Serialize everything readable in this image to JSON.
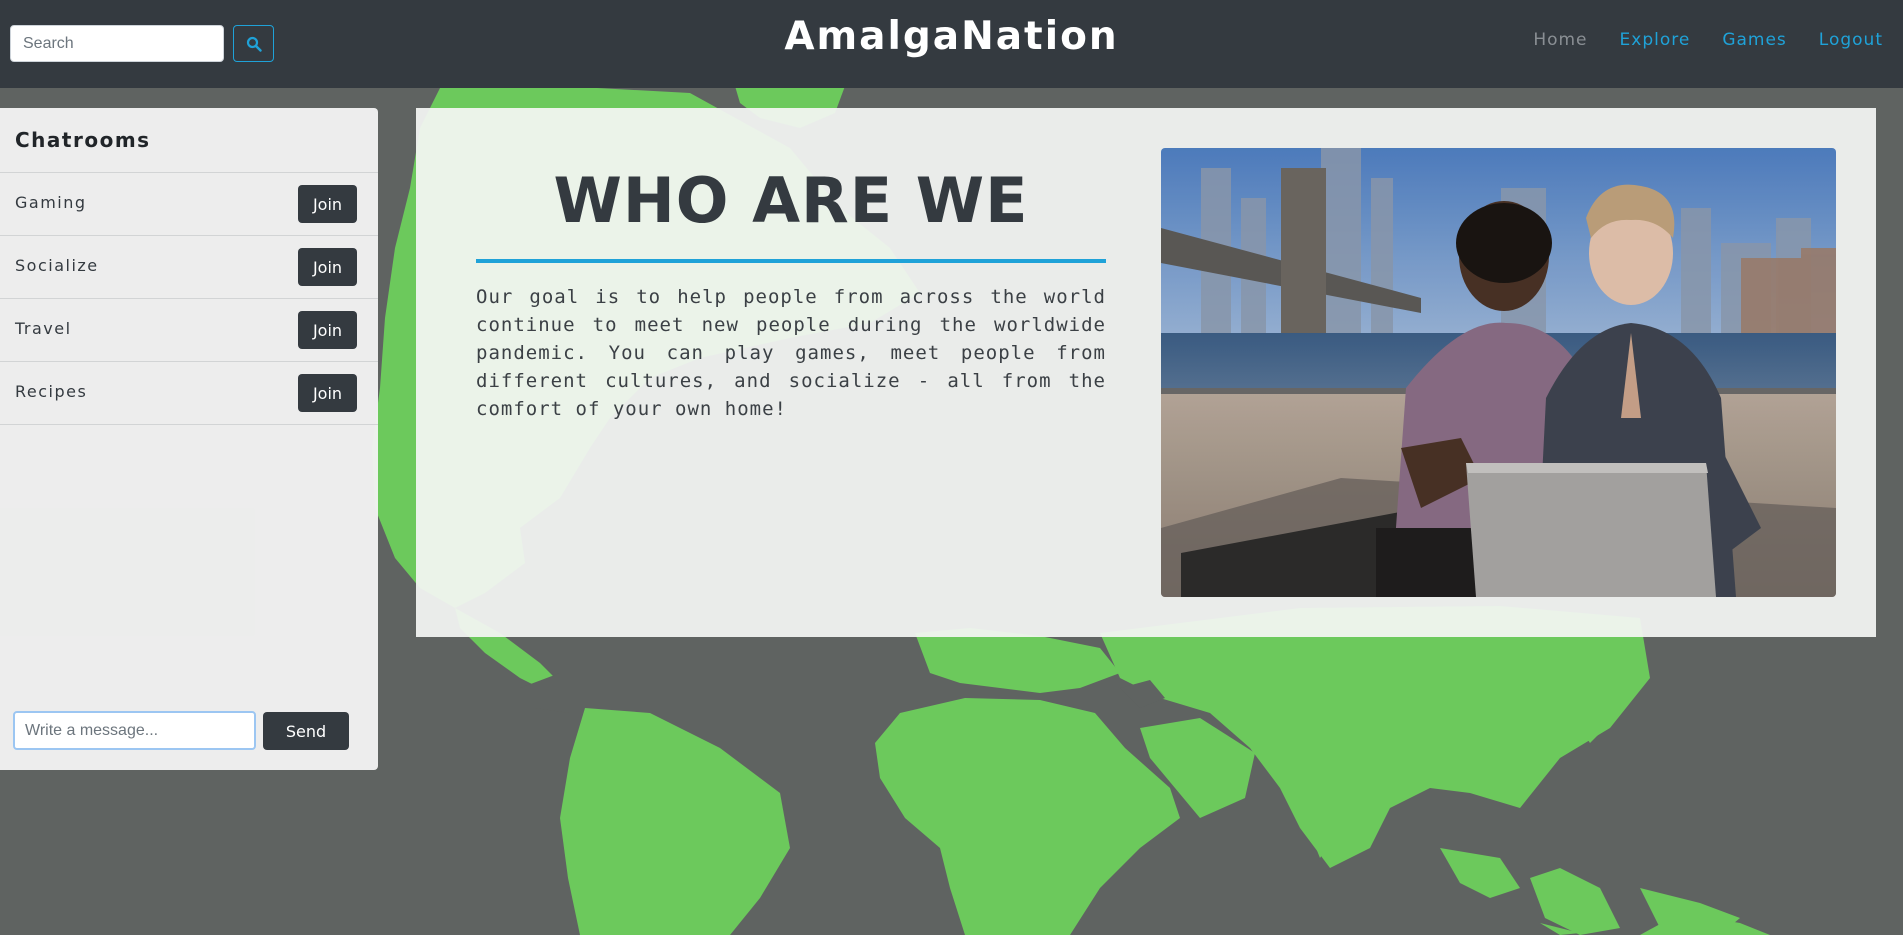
{
  "header": {
    "brand": "AmalgaNation",
    "search_placeholder": "Search",
    "search_icon": "search-icon",
    "nav": [
      {
        "label": "Home",
        "active": true
      },
      {
        "label": "Explore",
        "active": false
      },
      {
        "label": "Games",
        "active": false
      },
      {
        "label": "Logout",
        "active": false
      }
    ]
  },
  "sidebar": {
    "title": "Chatrooms",
    "rooms": [
      {
        "label": "Gaming",
        "button": "Join"
      },
      {
        "label": "Socialize",
        "button": "Join"
      },
      {
        "label": "Travel",
        "button": "Join"
      },
      {
        "label": "Recipes",
        "button": "Join"
      }
    ],
    "message_placeholder": "Write a message...",
    "send_label": "Send"
  },
  "main": {
    "heading": "WHO ARE WE",
    "body": "Our goal is to help people from across the world continue to meet new people during the worldwide pandemic. You can play games, meet people from different cultures, and socialize - all from the comfort of your own home!"
  },
  "colors": {
    "navbar": "#343a40",
    "accent": "#1fa2d8",
    "map_land": "#6cc95c",
    "map_ocean": "#5f6361",
    "button_dark": "#343a40"
  }
}
